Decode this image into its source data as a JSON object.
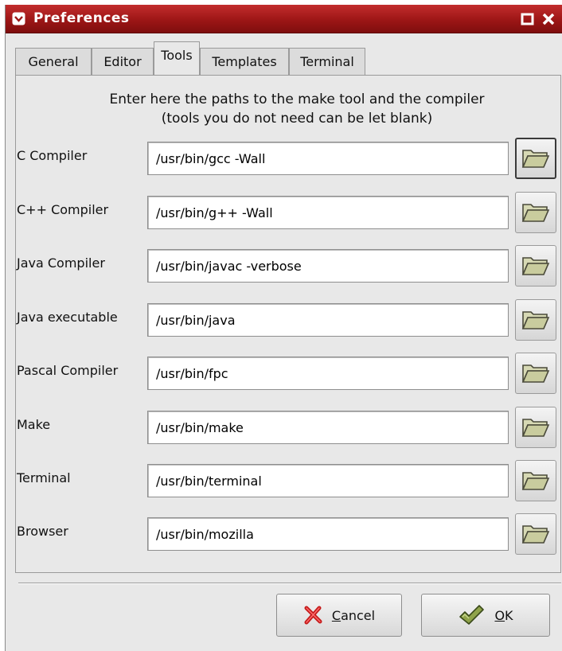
{
  "window": {
    "title": "Preferences",
    "menu_icon": "chevron-down-icon",
    "maximize_icon": "maximize-icon",
    "close_icon": "close-icon"
  },
  "tabs": [
    {
      "label": "General",
      "active": false
    },
    {
      "label": "Editor",
      "active": false
    },
    {
      "label": "Tools",
      "active": true
    },
    {
      "label": "Templates",
      "active": false
    },
    {
      "label": "Terminal",
      "active": false
    }
  ],
  "instructions": {
    "line1": "Enter here the paths to the make tool and the compiler",
    "line2": "(tools you do not need can be let blank)"
  },
  "tools": [
    {
      "label": "C Compiler",
      "value": "/usr/bin/gcc -Wall"
    },
    {
      "label": "C++ Compiler",
      "value": "/usr/bin/g++ -Wall"
    },
    {
      "label": "Java Compiler",
      "value": "/usr/bin/javac -verbose"
    },
    {
      "label": "Java executable",
      "value": "/usr/bin/java"
    },
    {
      "label": "Pascal Compiler",
      "value": "/usr/bin/fpc"
    },
    {
      "label": "Make",
      "value": "/usr/bin/make"
    },
    {
      "label": "Terminal",
      "value": "/usr/bin/terminal"
    },
    {
      "label": "Browser",
      "value": "/usr/bin/mozilla"
    }
  ],
  "browse_icon": "folder-open-icon",
  "buttons": {
    "cancel": {
      "label": "Cancel",
      "icon": "cancel-x-icon",
      "color": "#c41a1a"
    },
    "ok": {
      "label": "OK",
      "icon": "ok-checkmark-icon",
      "color": "#8fa34a"
    }
  },
  "colors": {
    "titlebar": "#9d1616",
    "folder_icon": "#c9cc9e"
  }
}
